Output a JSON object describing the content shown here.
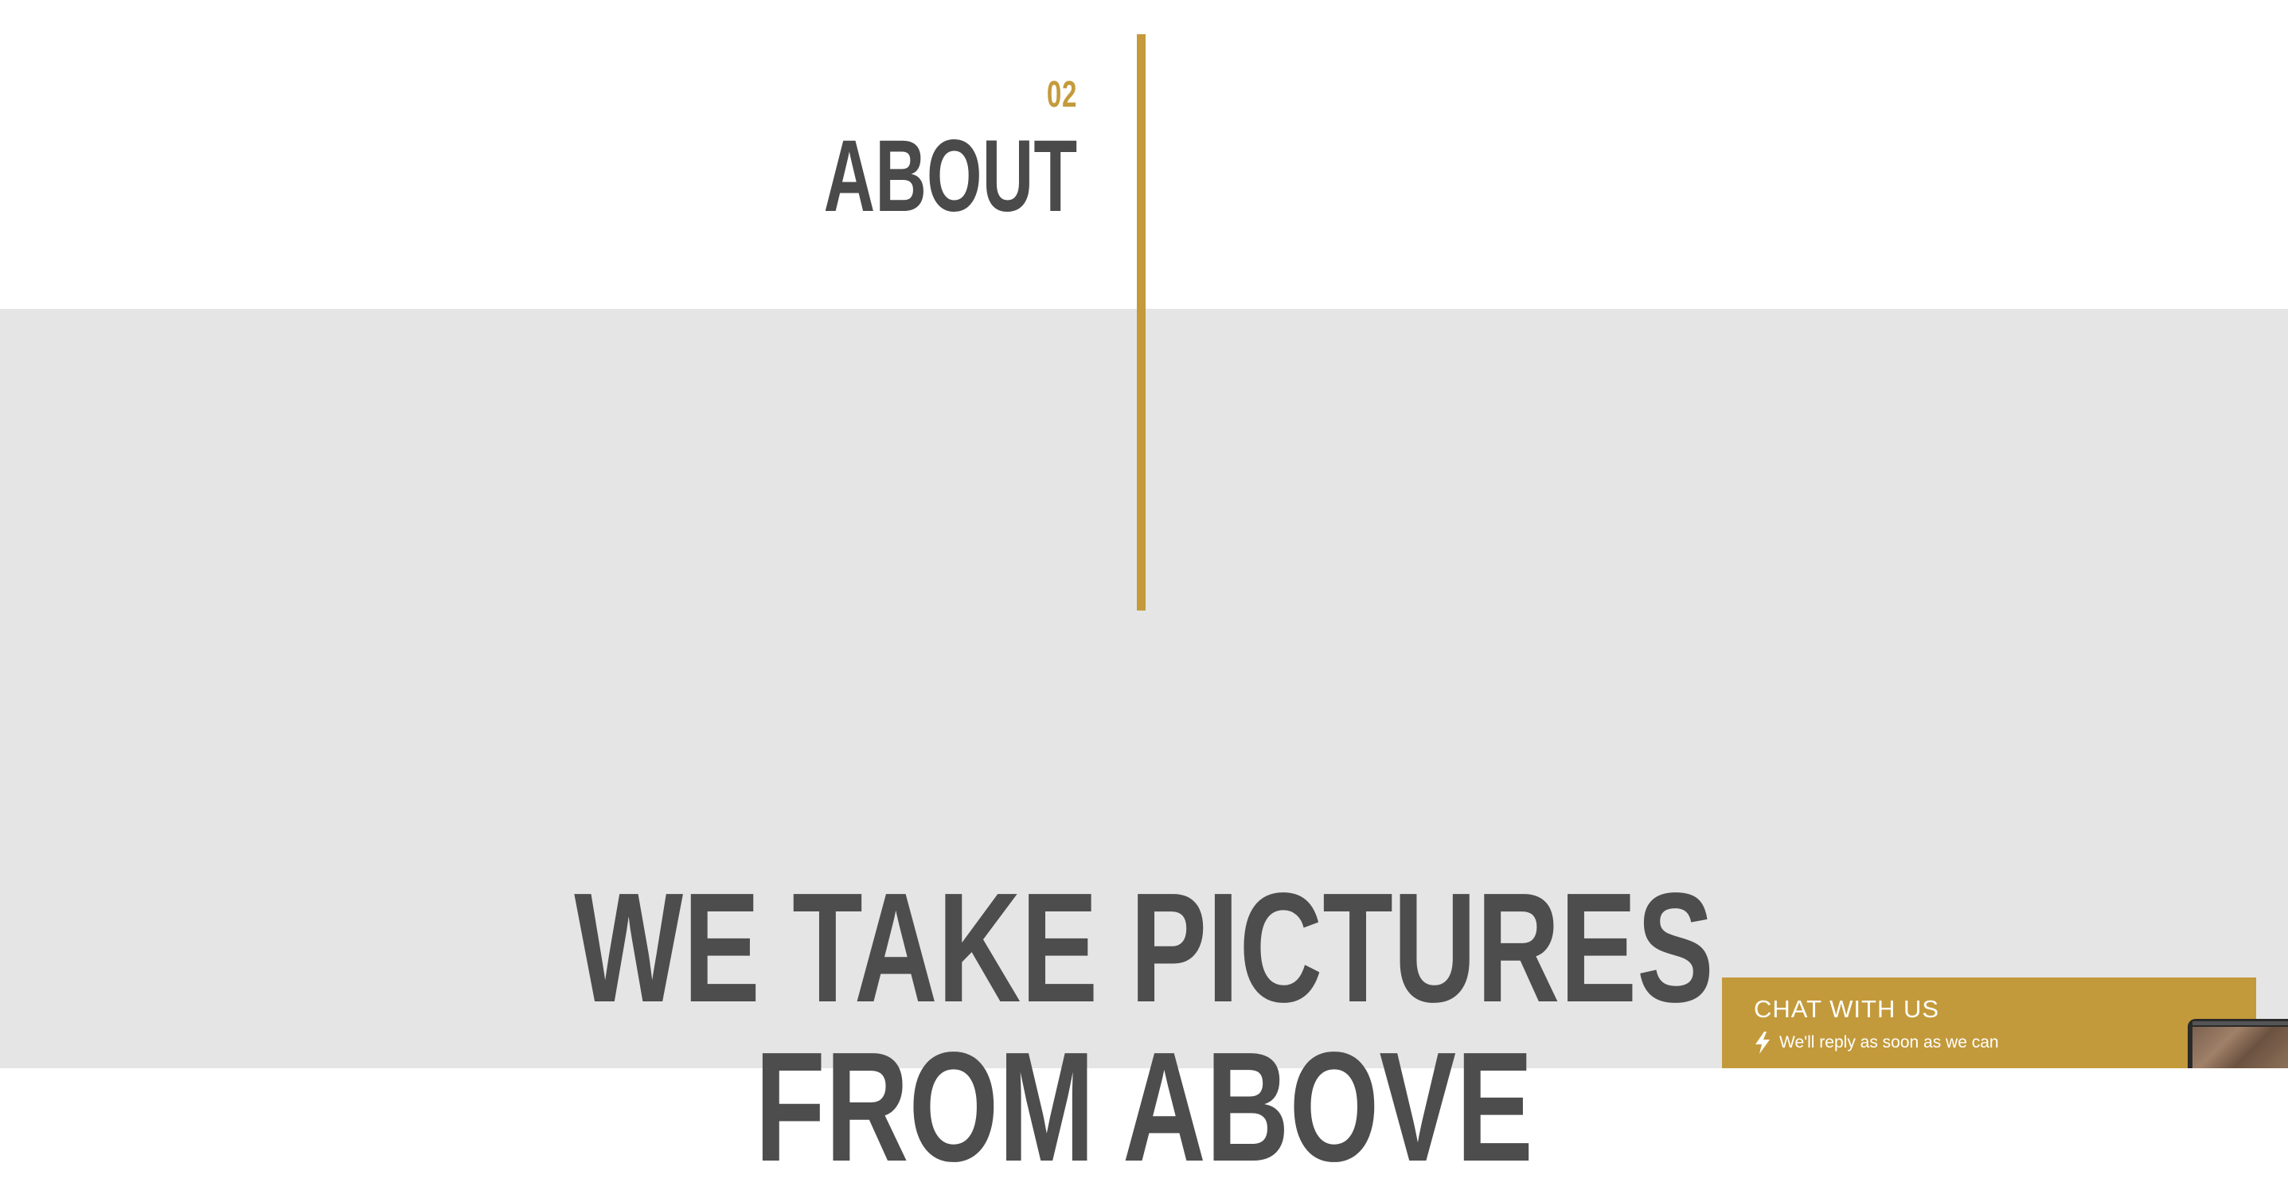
{
  "section": {
    "number": "02",
    "title": "ABOUT"
  },
  "hero": {
    "line1": "WE TAKE PICTURES",
    "line2": "FROM ABOVE"
  },
  "chat": {
    "title": "CHAT WITH US",
    "subtitle": "We'll reply as soon as we can",
    "icon": "lightning-bolt-icon"
  },
  "colors": {
    "accent": "#c49a3c",
    "heading_text": "#4a4a4a",
    "light_gray_background": "#e5e5e5",
    "white_background": "#ffffff"
  }
}
